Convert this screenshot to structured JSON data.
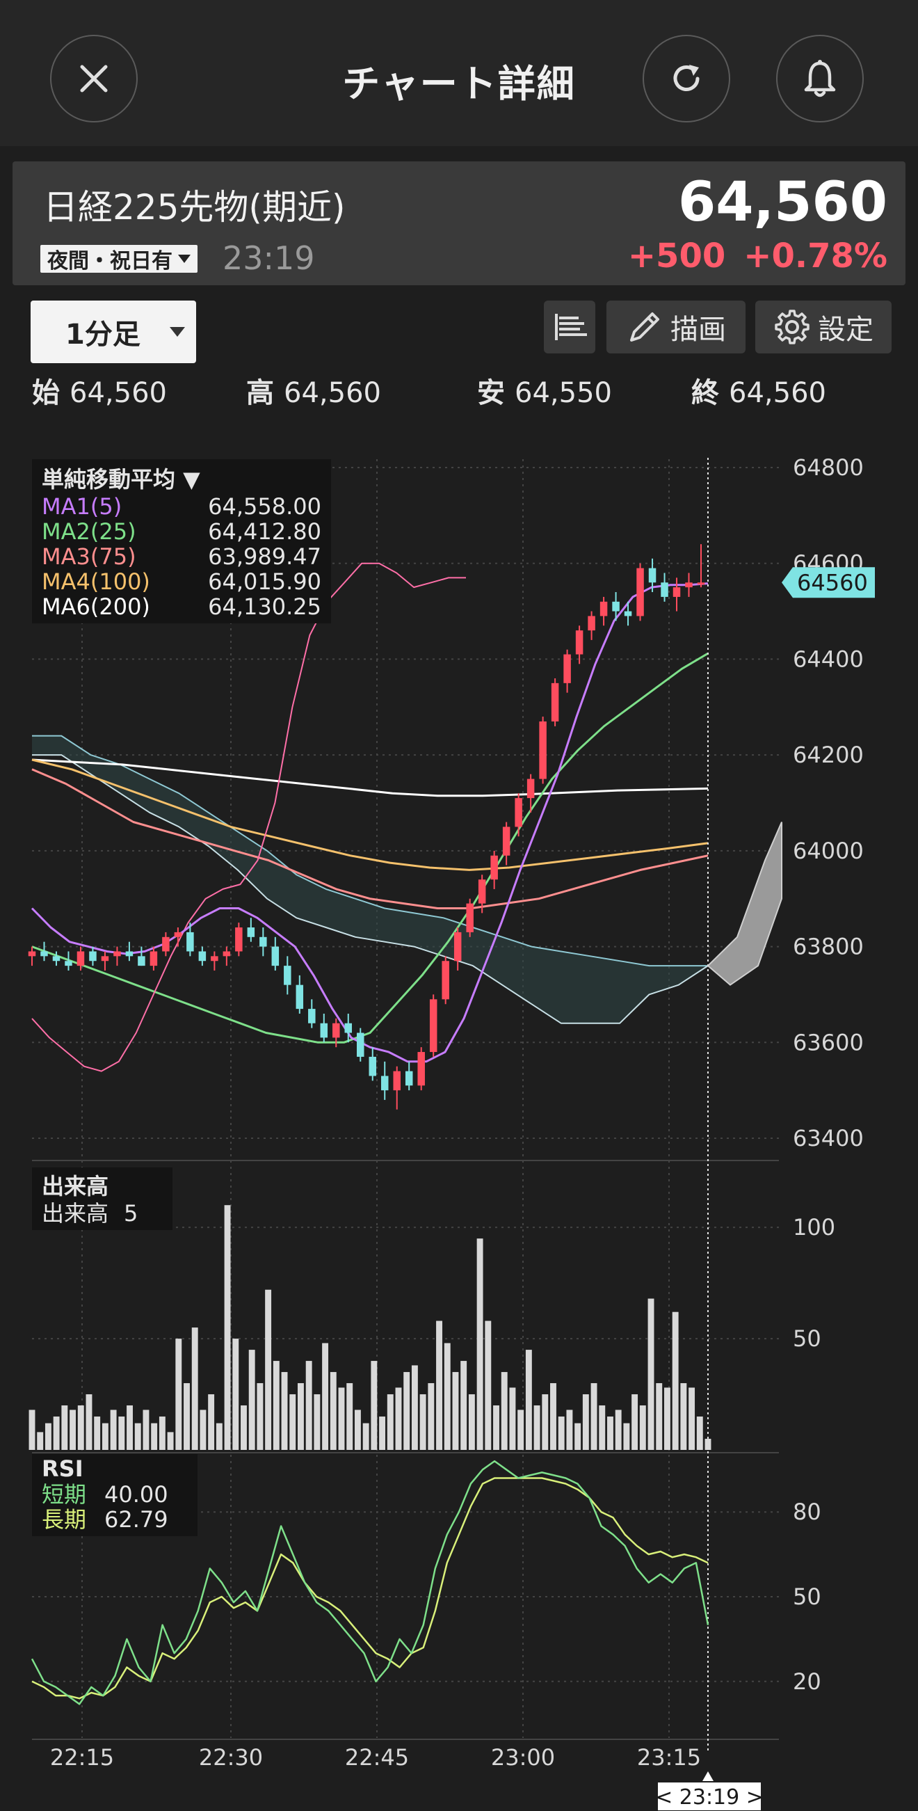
{
  "header": {
    "title": "チャート詳細",
    "close_icon": "close-icon",
    "refresh_icon": "refresh-icon",
    "bell_icon": "bell-icon"
  },
  "quote": {
    "name": "日経225先物(期近)",
    "price": "64,560",
    "session": "夜間・祝日有",
    "time": "23:19",
    "change": "+500",
    "change_pct": "+0.78%",
    "up_color": "#ff5c6c"
  },
  "toolbar": {
    "period": "1分足",
    "draw_label": "描画",
    "settings_label": "設定"
  },
  "ohlc": {
    "open_label": "始",
    "open": "64,560",
    "high_label": "高",
    "high": "64,560",
    "low_label": "安",
    "low": "64,550",
    "close_label": "終",
    "close": "64,560"
  },
  "chart_data": [
    {
      "type": "candlestick",
      "title": "単純移動平均",
      "ylim": [
        63400,
        64800
      ],
      "yticks": [
        "64800",
        "64600",
        "64400",
        "64200",
        "64000",
        "63800",
        "63600",
        "63400"
      ],
      "current_price_label": "64560",
      "series": [
        {
          "name": "MA1(5)",
          "value": "64,558.00",
          "color": "#c77dff"
        },
        {
          "name": "MA2(25)",
          "value": "64,412.80",
          "color": "#7ee08a"
        },
        {
          "name": "MA3(75)",
          "value": "63,989.47",
          "color": "#ff8f8f"
        },
        {
          "name": "MA4(100)",
          "value": "64,015.90",
          "color": "#f5c16c"
        },
        {
          "name": "MA6(200)",
          "value": "64,130.25",
          "color": "#ffffff"
        }
      ],
      "ma1_series": [
        63880,
        63840,
        63810,
        63800,
        63790,
        63785,
        63790,
        63805,
        63830,
        63860,
        63880,
        63880,
        63860,
        63830,
        63800,
        63740,
        63670,
        63610,
        63590,
        63580,
        63560,
        63560,
        63580,
        63650,
        63750,
        63850,
        63960,
        64060,
        64160,
        64280,
        64390,
        64480,
        64530,
        64550,
        64555,
        64555,
        64558
      ],
      "ma2_series": [
        63800,
        63780,
        63760,
        63740,
        63720,
        63700,
        63680,
        63660,
        63640,
        63620,
        63610,
        63600,
        63600,
        63620,
        63680,
        63740,
        63810,
        63890,
        63980,
        64070,
        64150,
        64210,
        64260,
        64300,
        64340,
        64380,
        64412
      ],
      "ma3_series": [
        64170,
        64140,
        64100,
        64060,
        64040,
        64020,
        64000,
        63980,
        63950,
        63920,
        63900,
        63890,
        63880,
        63880,
        63890,
        63900,
        63920,
        63940,
        63960,
        63975,
        63990
      ],
      "ma4_series": [
        64190,
        64170,
        64140,
        64110,
        64080,
        64050,
        64030,
        64010,
        63990,
        63975,
        63965,
        63960,
        63965,
        63975,
        63985,
        63995,
        64005,
        64016
      ],
      "ma6_series": [
        64190,
        64185,
        64180,
        64170,
        64160,
        64150,
        64140,
        64130,
        64120,
        64115,
        64115,
        64118,
        64122,
        64126,
        64128,
        64130
      ],
      "cloud_upper": [
        64240,
        64240,
        64200,
        64180,
        64150,
        64120,
        64080,
        64040,
        64000,
        63950,
        63920,
        63900,
        63880,
        63870,
        63860,
        63840,
        63820,
        63800,
        63790,
        63780,
        63770,
        63760,
        63760,
        63760
      ],
      "cloud_lower": [
        64200,
        64200,
        64160,
        64120,
        64080,
        64050,
        64010,
        63960,
        63900,
        63860,
        63840,
        63820,
        63810,
        63800,
        63780,
        63760,
        63720,
        63680,
        63640,
        63640,
        63640,
        63700,
        63720,
        63760
      ],
      "rsi_overlay": [
        63650,
        63610,
        63580,
        63550,
        63540,
        63560,
        63620,
        63700,
        63780,
        63850,
        63900,
        63920,
        63930,
        63980,
        64100,
        64300,
        64450,
        64520,
        64560,
        64600,
        64600,
        64580,
        64550,
        64560,
        64570,
        64570
      ],
      "candles": [
        [
          63780,
          63800,
          63760,
          63790
        ],
        [
          63790,
          63810,
          63770,
          63780
        ],
        [
          63780,
          63790,
          63760,
          63770
        ],
        [
          63770,
          63790,
          63750,
          63760
        ],
        [
          63760,
          63800,
          63750,
          63790
        ],
        [
          63790,
          63800,
          63760,
          63770
        ],
        [
          63770,
          63790,
          63750,
          63780
        ],
        [
          63780,
          63800,
          63760,
          63790
        ],
        [
          63790,
          63810,
          63770,
          63780
        ],
        [
          63780,
          63800,
          63760,
          63760
        ],
        [
          63760,
          63800,
          63750,
          63790
        ],
        [
          63790,
          63830,
          63780,
          63820
        ],
        [
          63820,
          63840,
          63800,
          63830
        ],
        [
          63830,
          63850,
          63780,
          63790
        ],
        [
          63790,
          63800,
          63760,
          63770
        ],
        [
          63770,
          63790,
          63750,
          63780
        ],
        [
          63780,
          63800,
          63760,
          63790
        ],
        [
          63790,
          63850,
          63780,
          63840
        ],
        [
          63840,
          63860,
          63810,
          63820
        ],
        [
          63820,
          63840,
          63780,
          63800
        ],
        [
          63800,
          63820,
          63750,
          63760
        ],
        [
          63760,
          63780,
          63700,
          63720
        ],
        [
          63720,
          63740,
          63660,
          63670
        ],
        [
          63670,
          63690,
          63630,
          63640
        ],
        [
          63640,
          63660,
          63600,
          63610
        ],
        [
          63610,
          63650,
          63590,
          63640
        ],
        [
          63640,
          63660,
          63600,
          63620
        ],
        [
          63620,
          63630,
          63560,
          63570
        ],
        [
          63570,
          63590,
          63520,
          63530
        ],
        [
          63530,
          63560,
          63480,
          63500
        ],
        [
          63500,
          63550,
          63460,
          63540
        ],
        [
          63540,
          63560,
          63500,
          63510
        ],
        [
          63510,
          63590,
          63500,
          63580
        ],
        [
          63580,
          63700,
          63570,
          63690
        ],
        [
          63690,
          63780,
          63680,
          63770
        ],
        [
          63770,
          63840,
          63750,
          63830
        ],
        [
          63830,
          63900,
          63820,
          63890
        ],
        [
          63890,
          63950,
          63870,
          63940
        ],
        [
          63940,
          64000,
          63920,
          63990
        ],
        [
          63990,
          64060,
          63970,
          64050
        ],
        [
          64050,
          64120,
          64030,
          64110
        ],
        [
          64110,
          64160,
          64080,
          64150
        ],
        [
          64150,
          64280,
          64140,
          64270
        ],
        [
          64270,
          64360,
          64260,
          64350
        ],
        [
          64350,
          64420,
          64330,
          64410
        ],
        [
          64410,
          64470,
          64390,
          64460
        ],
        [
          64460,
          64500,
          64440,
          64490
        ],
        [
          64490,
          64530,
          64470,
          64520
        ],
        [
          64520,
          64540,
          64480,
          64500
        ],
        [
          64500,
          64520,
          64470,
          64490
        ],
        [
          64490,
          64600,
          64480,
          64590
        ],
        [
          64590,
          64610,
          64540,
          64560
        ],
        [
          64560,
          64580,
          64520,
          64530
        ],
        [
          64530,
          64570,
          64500,
          64550
        ],
        [
          64550,
          64580,
          64530,
          64560
        ],
        [
          64560,
          64640,
          64550,
          64560
        ]
      ]
    },
    {
      "type": "bar",
      "title": "出来高",
      "label": "出来高",
      "value": "5",
      "ylim": [
        0,
        120
      ],
      "yticks": [
        "100",
        "50"
      ],
      "values": [
        18,
        8,
        12,
        15,
        20,
        18,
        20,
        25,
        15,
        12,
        18,
        15,
        20,
        12,
        18,
        12,
        15,
        8,
        50,
        30,
        55,
        18,
        25,
        12,
        110,
        50,
        20,
        45,
        30,
        72,
        40,
        35,
        25,
        30,
        40,
        25,
        48,
        35,
        28,
        30,
        18,
        12,
        40,
        15,
        25,
        28,
        35,
        38,
        25,
        30,
        58,
        48,
        35,
        40,
        25,
        95,
        58,
        20,
        35,
        28,
        18,
        45,
        20,
        25,
        30,
        15,
        18,
        12,
        25,
        30,
        20,
        15,
        18,
        12,
        25,
        20,
        68,
        30,
        28,
        62,
        30,
        28,
        15,
        5
      ],
      "bar_color": "#d9d9d9"
    },
    {
      "type": "line",
      "title": "RSI",
      "ylim": [
        0,
        100
      ],
      "yticks": [
        "80",
        "50",
        "20"
      ],
      "series": [
        {
          "name": "短期",
          "value": "40.00",
          "color": "#7ee08a",
          "values": [
            28,
            20,
            18,
            15,
            12,
            18,
            15,
            22,
            35,
            25,
            20,
            40,
            30,
            35,
            45,
            60,
            55,
            48,
            52,
            45,
            60,
            75,
            65,
            55,
            48,
            45,
            40,
            35,
            30,
            20,
            25,
            35,
            30,
            40,
            60,
            72,
            80,
            90,
            95,
            98,
            95,
            92,
            93,
            94,
            93,
            92,
            90,
            85,
            75,
            72,
            68,
            60,
            55,
            58,
            55,
            60,
            62,
            40
          ]
        },
        {
          "name": "長期",
          "value": "62.79",
          "color": "#d9f07a",
          "values": [
            20,
            18,
            15,
            15,
            14,
            16,
            15,
            18,
            25,
            22,
            20,
            30,
            28,
            32,
            38,
            48,
            50,
            46,
            48,
            45,
            55,
            65,
            62,
            55,
            50,
            48,
            45,
            40,
            35,
            30,
            28,
            25,
            30,
            32,
            45,
            62,
            72,
            82,
            90,
            92,
            92,
            92,
            92,
            92,
            91,
            90,
            88,
            85,
            80,
            78,
            72,
            68,
            65,
            66,
            64,
            65,
            64,
            62
          ]
        }
      ]
    }
  ],
  "time_axis": {
    "labels": [
      "22:15",
      "22:30",
      "22:45",
      "23:00",
      "23:15"
    ],
    "cursor_label": "< 23:19 >"
  }
}
